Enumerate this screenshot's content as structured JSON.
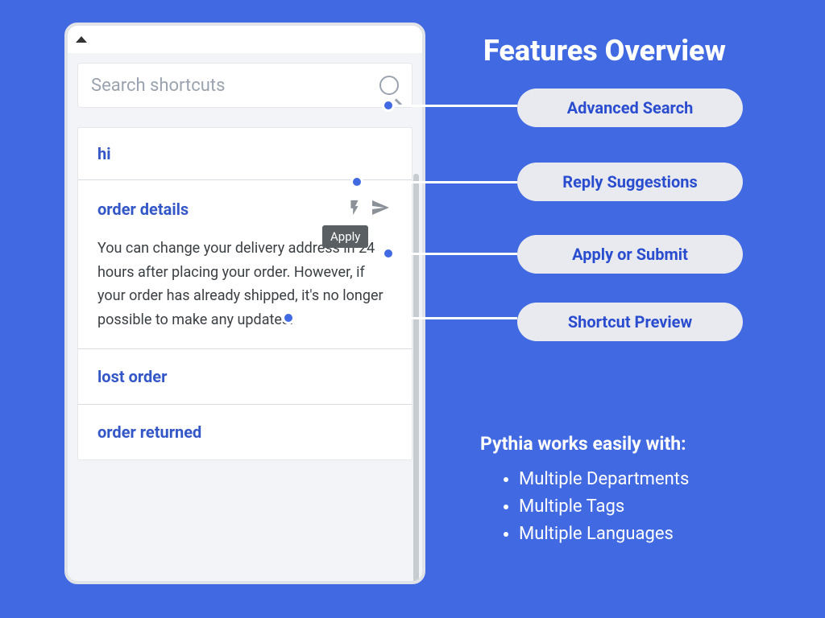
{
  "heading": "Features Overview",
  "search": {
    "placeholder": "Search shortcuts"
  },
  "tooltip": "Apply",
  "shortcuts": {
    "hi": {
      "title": "hi"
    },
    "order_details": {
      "title": "order details",
      "body": "You can change your delivery address in 24 hours after placing your order. However, if your order has already shipped, it's no longer possible to make any updates."
    },
    "lost_order": {
      "title": "lost order"
    },
    "order_returned": {
      "title": "order returned"
    }
  },
  "callouts": {
    "advanced_search": "Advanced Search",
    "reply_suggestions": "Reply Suggestions",
    "apply_submit": "Apply or Submit",
    "shortcut_preview": "Shortcut Preview"
  },
  "works_with": {
    "title": "Pythia works easily with:",
    "items": [
      "Multiple Departments",
      "Multiple Tags",
      "Multiple Languages"
    ]
  }
}
